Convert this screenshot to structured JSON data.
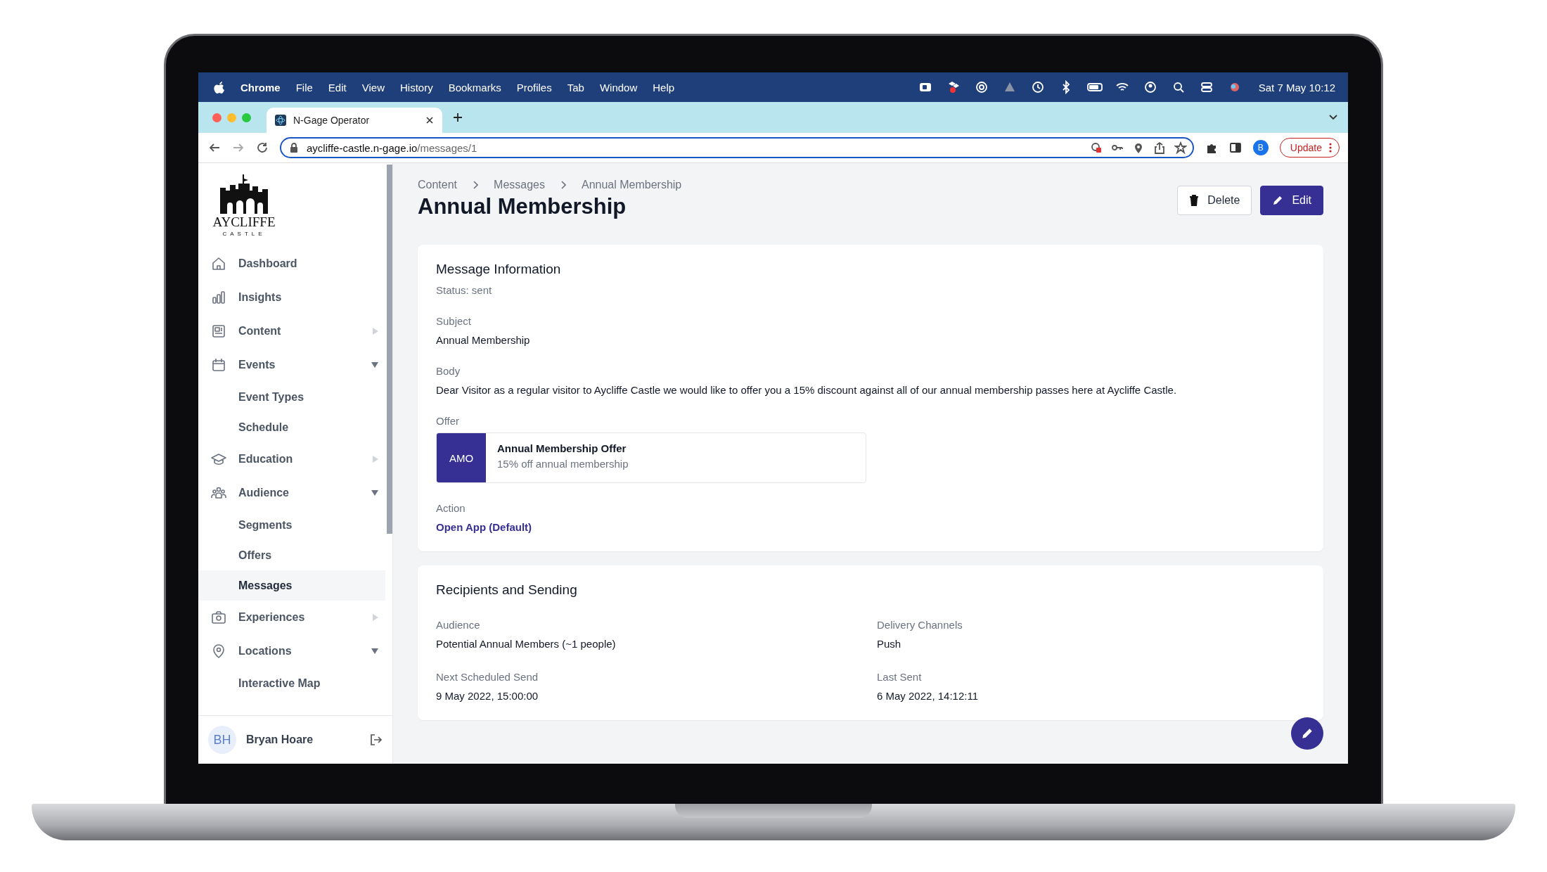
{
  "menu_bar": {
    "app": "Chrome",
    "menus": [
      "File",
      "Edit",
      "View",
      "History",
      "Bookmarks",
      "Profiles",
      "Tab",
      "Window",
      "Help"
    ],
    "clock": "Sat 7 May 10:12"
  },
  "browser": {
    "tabs": [
      {
        "title": "N-Gage Operator",
        "selected": true
      }
    ],
    "url_host": "aycliffe-castle.n-gage.io",
    "url_path": "/messages/1",
    "profile": "B",
    "update_button": "Update"
  },
  "sidebar": {
    "logo": {
      "name": "AYCLIFFE",
      "tagline": "CASTLE"
    },
    "items": [
      {
        "label": "Dashboard",
        "selected": false
      },
      {
        "label": "Insights",
        "selected": false
      },
      {
        "label": "Content",
        "selected": false,
        "expanded": false
      },
      {
        "label": "Events",
        "selected": false,
        "expanded": true,
        "children": [
          {
            "label": "Event Types",
            "selected": false
          },
          {
            "label": "Schedule",
            "selected": false
          }
        ]
      },
      {
        "label": "Education",
        "selected": false,
        "expanded": false
      },
      {
        "label": "Audience",
        "selected": false,
        "expanded": true,
        "children": [
          {
            "label": "Segments",
            "selected": false
          },
          {
            "label": "Offers",
            "selected": false
          },
          {
            "label": "Messages",
            "selected": true
          }
        ]
      },
      {
        "label": "Experiences",
        "selected": false,
        "expanded": false
      },
      {
        "label": "Locations",
        "selected": false,
        "expanded": true,
        "children": [
          {
            "label": "Interactive Map",
            "selected": false
          }
        ]
      }
    ],
    "user": {
      "initials": "BH",
      "name": "Bryan Hoare"
    }
  },
  "breadcrumb": [
    "Content",
    "Messages",
    "Annual Membership"
  ],
  "title": "Annual Membership",
  "actions": [
    {
      "label": "Delete",
      "kind": "secondary"
    },
    {
      "label": "Edit",
      "kind": "primary"
    }
  ],
  "message_information": {
    "title": "Message Information",
    "status": "Status: sent",
    "fields": [
      {
        "kind": "text",
        "label": "Subject",
        "value": "Annual Membership"
      },
      {
        "kind": "text",
        "label": "Body",
        "value": "Dear Visitor as a regular visitor to Aycliffe Castle we would like to offer you a 15% discount against all of our annual membership passes here at Aycliffe Castle."
      },
      {
        "kind": "offer",
        "label": "Offer",
        "badge": "AMO",
        "name": "Annual Membership Offer",
        "description": "15% off annual membership"
      },
      {
        "kind": "link",
        "label": "Action",
        "value": "Open App (Default)"
      }
    ]
  },
  "recipients": {
    "title": "Recipients and Sending",
    "fields": [
      {
        "label": "Audience",
        "value": "Potential Annual Members (~1 people)"
      },
      {
        "label": "Delivery Channels",
        "value": "Push"
      },
      {
        "label": "Next Scheduled Send",
        "value": "9 May 2022, 15:00:00"
      },
      {
        "label": "Last Sent",
        "value": "6 May 2022, 14:12:11"
      }
    ]
  }
}
